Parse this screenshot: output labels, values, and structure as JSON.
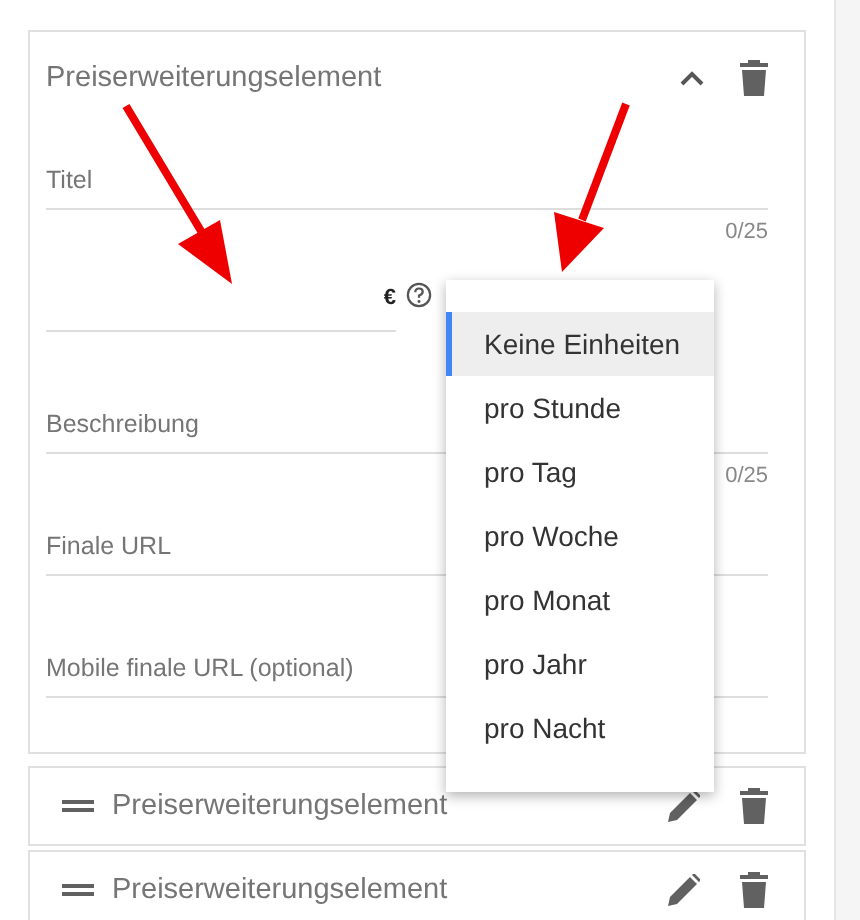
{
  "expanded_item": {
    "title": "Preiserweiterungselement",
    "expanded": true,
    "fields": [
      {
        "kind": "text",
        "placeholder": "Titel",
        "counter": "0/25"
      },
      {
        "kind": "price",
        "currency": "€"
      },
      {
        "kind": "text",
        "placeholder": "Beschreibung",
        "counter": "0/25"
      },
      {
        "kind": "text",
        "placeholder": "Finale URL"
      },
      {
        "kind": "text",
        "placeholder": "Mobile finale URL (optional)"
      }
    ]
  },
  "unit_menu": {
    "options": [
      {
        "label": "Keine Einheiten",
        "selected": true
      },
      {
        "label": "pro Stunde",
        "selected": false
      },
      {
        "label": "pro Tag",
        "selected": false
      },
      {
        "label": "pro Woche",
        "selected": false
      },
      {
        "label": "pro Monat",
        "selected": false
      },
      {
        "label": "pro Jahr",
        "selected": false
      },
      {
        "label": "pro Nacht",
        "selected": false
      }
    ]
  },
  "collapsed_items": [
    {
      "title": "Preiserweiterungselement"
    },
    {
      "title": "Preiserweiterungselement"
    }
  ]
}
